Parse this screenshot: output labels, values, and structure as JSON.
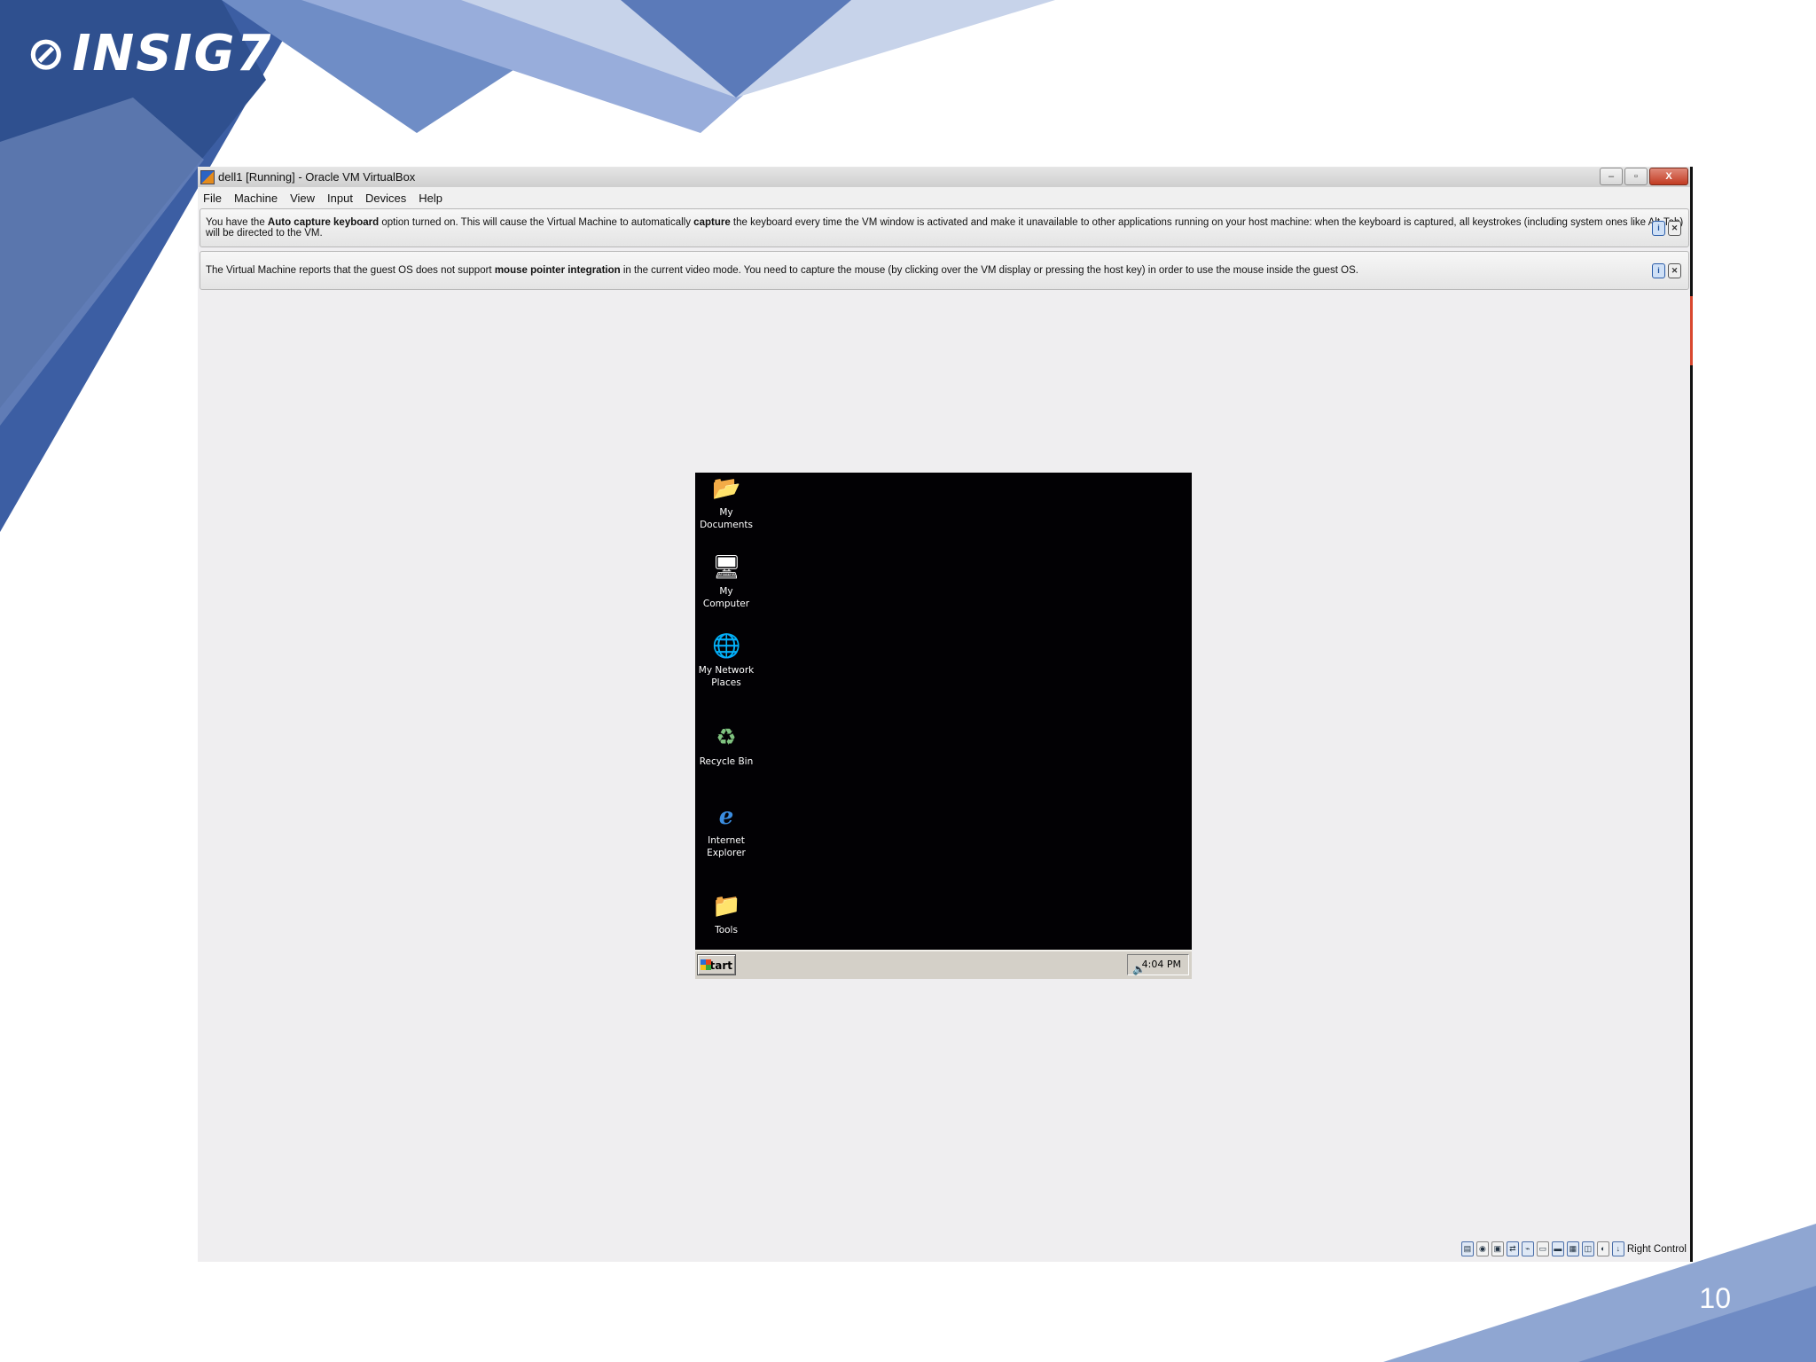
{
  "slide": {
    "logo_text": "INSIG7",
    "page_number": "10"
  },
  "window": {
    "title": "dell1 [Running] - Oracle VM VirtualBox",
    "controls": {
      "minimize": "–",
      "restore": "▫",
      "close": "X"
    }
  },
  "menubar": {
    "items": [
      "File",
      "Machine",
      "View",
      "Input",
      "Devices",
      "Help"
    ]
  },
  "banners": {
    "keyboard": {
      "pre": "You have the ",
      "bold1": "Auto capture keyboard",
      "mid1": " option turned on. This will cause the Virtual Machine to automatically ",
      "bold2": "capture",
      "post": " the keyboard every time the VM window is activated and make it unavailable to other applications running on your host machine: when the keyboard is captured, all keystrokes (including system ones like Alt-Tab) will be directed to the VM."
    },
    "mouse": {
      "pre": "The Virtual Machine reports that the guest OS does not support ",
      "bold1": "mouse pointer integration",
      "post": " in the current video mode. You need to capture the mouse (by clicking over the VM display or pressing the host key) in order to use the mouse inside the guest OS."
    }
  },
  "guest": {
    "desktop_icons": [
      {
        "label": "My Documents",
        "icon": "documents-folder-icon"
      },
      {
        "label": "My Computer",
        "icon": "computer-icon"
      },
      {
        "label": "My Network Places",
        "icon": "network-icon"
      },
      {
        "label": "Recycle Bin",
        "icon": "recycle-bin-icon"
      },
      {
        "label": "Internet Explorer",
        "icon": "internet-explorer-icon"
      },
      {
        "label": "Tools",
        "icon": "folder-icon"
      }
    ],
    "taskbar": {
      "start_label": "Start",
      "clock": "4:04 PM"
    }
  },
  "statusbar": {
    "host_key": "Right Control"
  },
  "colors": {
    "slide_blue": "#3b5fa6",
    "slide_light_blue": "#8fa6d2",
    "guest_bg": "#020104",
    "taskbar": "#d4d0c8"
  }
}
